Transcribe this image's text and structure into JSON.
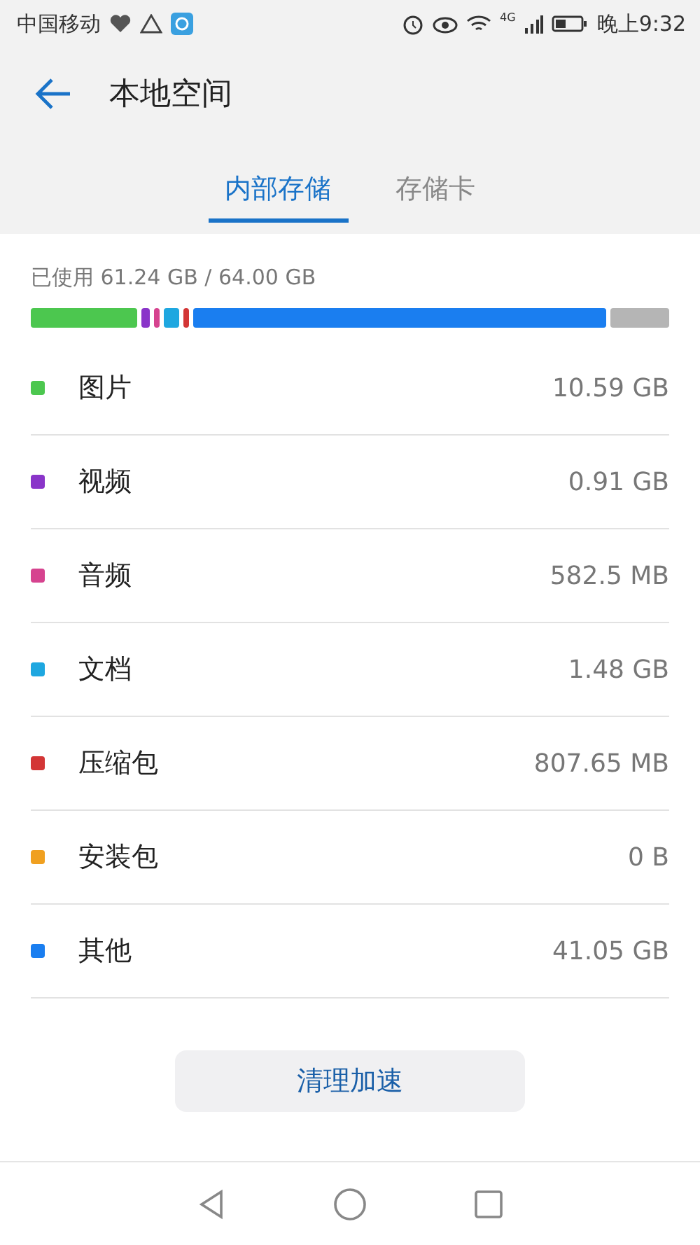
{
  "status_bar": {
    "carrier": "中国移动",
    "network": "4G",
    "time": "晚上9:32"
  },
  "header": {
    "title": "本地空间"
  },
  "tabs": [
    {
      "label": "内部存储",
      "selected": true
    },
    {
      "label": "存储卡",
      "selected": false
    }
  ],
  "usage": {
    "label": "已使用 61.24 GB / 64.00 GB"
  },
  "storage_bar": [
    {
      "color": "#4cc74f"
    },
    {
      "color": "#8a35c9"
    },
    {
      "color": "#d6438f"
    },
    {
      "color": "#1ea7e0"
    },
    {
      "color": "#d33636"
    },
    {
      "color": "#1a7ef0"
    },
    {
      "color": "#b5b5b5"
    }
  ],
  "categories": [
    {
      "name": "图片",
      "size": "10.59 GB",
      "color": "#4cc74f"
    },
    {
      "name": "视频",
      "size": "0.91 GB",
      "color": "#8a35c9"
    },
    {
      "name": "音频",
      "size": "582.5 MB",
      "color": "#d6438f"
    },
    {
      "name": "文档",
      "size": "1.48 GB",
      "color": "#1ea7e0"
    },
    {
      "name": "压缩包",
      "size": "807.65 MB",
      "color": "#d33636"
    },
    {
      "name": "安装包",
      "size": "0 B",
      "color": "#f0a020"
    },
    {
      "name": "其他",
      "size": "41.05 GB",
      "color": "#1a7ef0"
    }
  ],
  "clean_button": {
    "label": "清理加速"
  }
}
